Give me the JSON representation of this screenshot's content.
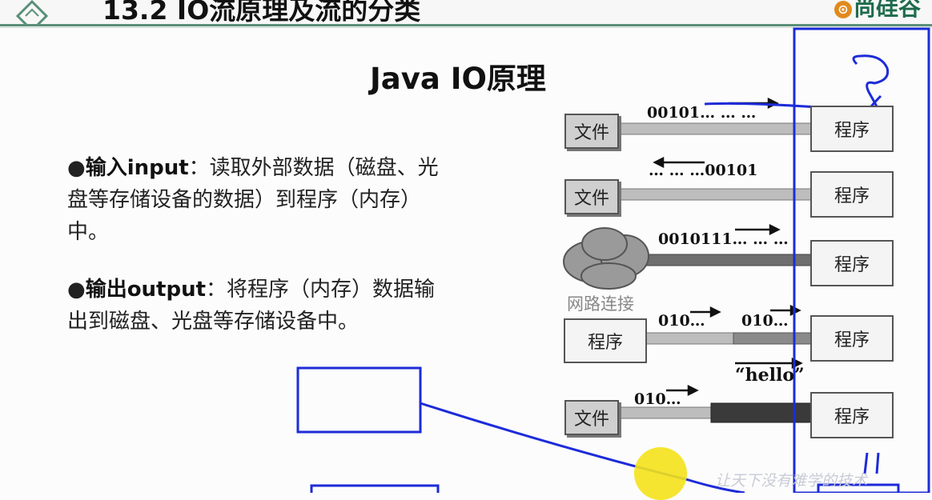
{
  "header": {
    "title": "13.2 IO流原理及流的分类",
    "brand": "尚硅谷",
    "brand_mark": "⊙"
  },
  "slide": {
    "title": "Java IO原理",
    "bullets": [
      {
        "marker": "●",
        "term": "输入input",
        "text": "：读取外部数据（磁盘、光盘等存储设备的数据）到程序（内存）中。"
      },
      {
        "marker": "●",
        "term": "输出output",
        "text": "：将程序（内存）数据输出到磁盘、光盘等存储设备中。"
      }
    ]
  },
  "diagram": {
    "file_label": "文件",
    "program_label": "程序",
    "network_label": "网路连接",
    "rows": [
      {
        "flow_label": "00101… … …"
      },
      {
        "flow_label": "… … …00101"
      },
      {
        "flow_label": "0010111… … …"
      },
      {
        "flow_label_1": "010…",
        "flow_label_2": "010…"
      },
      {
        "flow_label_1": "010…",
        "flow_label_2": "“hello”"
      }
    ]
  },
  "watermark": "让天下没有难学的技术",
  "colors": {
    "header_rule": "#5a8f79",
    "annotation": "#1d2bd9",
    "pointer": "#f4e21a",
    "brand": "#1e6b4b"
  }
}
